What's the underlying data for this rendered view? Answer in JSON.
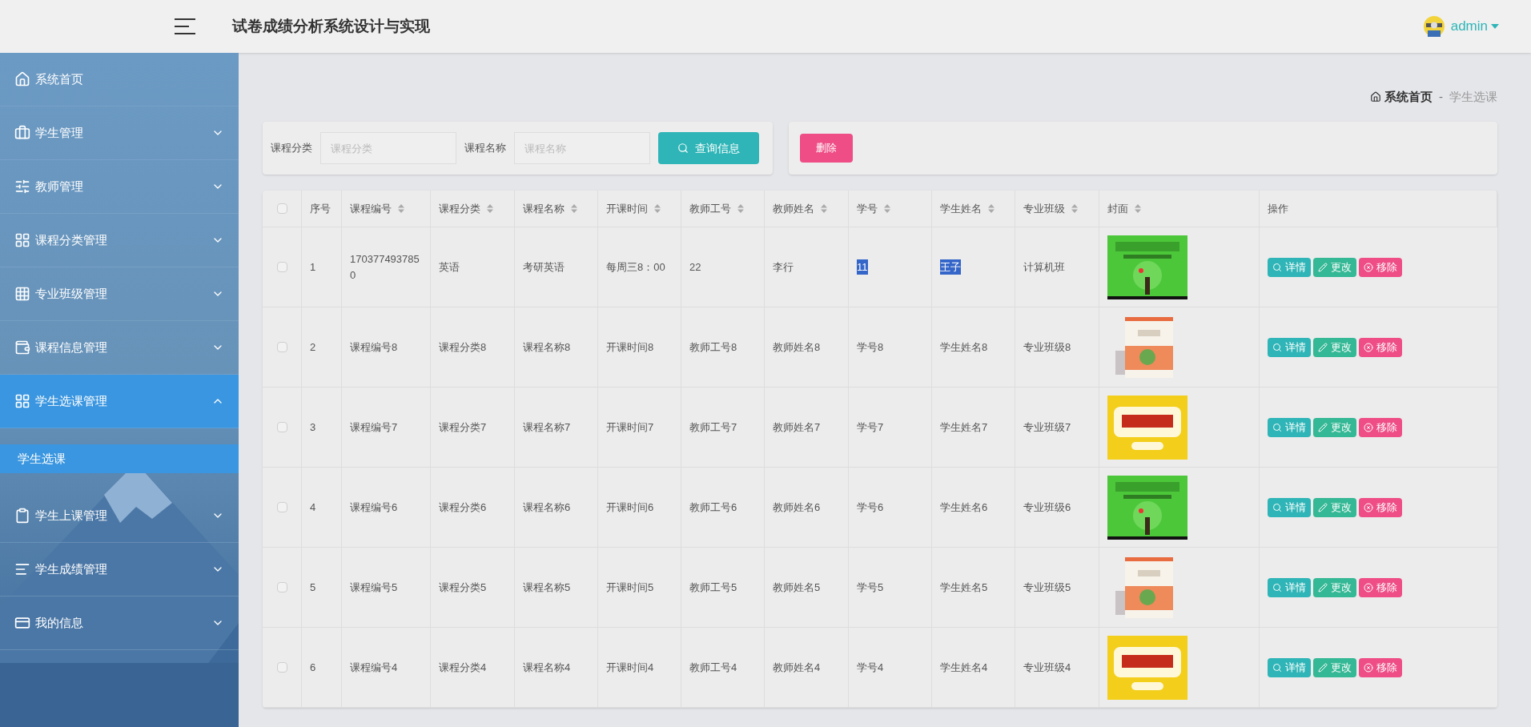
{
  "header": {
    "title": "试卷成绩分析系统设计与实现",
    "user": "admin"
  },
  "sidebar": {
    "items": [
      {
        "label": "系统首页",
        "expandable": false,
        "expanded": false
      },
      {
        "label": "学生管理",
        "expandable": true,
        "expanded": false
      },
      {
        "label": "教师管理",
        "expandable": true,
        "expanded": false
      },
      {
        "label": "课程分类管理",
        "expandable": true,
        "expanded": false
      },
      {
        "label": "专业班级管理",
        "expandable": true,
        "expanded": false
      },
      {
        "label": "课程信息管理",
        "expandable": true,
        "expanded": false
      },
      {
        "label": "学生选课管理",
        "expandable": true,
        "expanded": true,
        "children": [
          {
            "label": "学生选课",
            "selected": true
          }
        ]
      },
      {
        "label": "学生上课管理",
        "expandable": true,
        "expanded": false
      },
      {
        "label": "学生成绩管理",
        "expandable": true,
        "expanded": false
      },
      {
        "label": "我的信息",
        "expandable": true,
        "expanded": false
      }
    ]
  },
  "breadcrumb": {
    "home": "系统首页",
    "separator": "-",
    "current": "学生选课"
  },
  "filters": [
    {
      "label": "课程分类",
      "placeholder": "课程分类"
    },
    {
      "label": "课程名称",
      "placeholder": "课程名称"
    }
  ],
  "search_button": "查询信息",
  "delete_button": "删除",
  "table": {
    "select_all_checked": false,
    "columns": [
      {
        "label": "序号",
        "sortable": false
      },
      {
        "label": "课程编号",
        "sortable": true
      },
      {
        "label": "课程分类",
        "sortable": true
      },
      {
        "label": "课程名称",
        "sortable": true
      },
      {
        "label": "开课时间",
        "sortable": true
      },
      {
        "label": "教师工号",
        "sortable": true
      },
      {
        "label": "教师姓名",
        "sortable": true
      },
      {
        "label": "学号",
        "sortable": true
      },
      {
        "label": "学生姓名",
        "sortable": true
      },
      {
        "label": "专业班级",
        "sortable": true
      },
      {
        "label": "封面",
        "sortable": true
      },
      {
        "label": "操作",
        "sortable": false
      }
    ],
    "rows": [
      {
        "checked": false,
        "cells": [
          {
            "text": "1",
            "highlighted": false
          },
          {
            "text": "1703774937850",
            "highlighted": false
          },
          {
            "text": "英语",
            "highlighted": false
          },
          {
            "text": "考研英语",
            "highlighted": false
          },
          {
            "text": "每周三8：00",
            "highlighted": false
          },
          {
            "text": "22",
            "highlighted": false
          },
          {
            "text": "李行",
            "highlighted": false
          },
          {
            "text": "11",
            "highlighted": true
          },
          {
            "text": "王子",
            "highlighted": true
          },
          {
            "text": "计算机班",
            "highlighted": false
          }
        ],
        "actions": [
          {
            "kind": "view",
            "label": "详情"
          },
          {
            "kind": "edit",
            "label": "更改"
          },
          {
            "kind": "delete",
            "label": "移除"
          }
        ]
      },
      {
        "checked": false,
        "cells": [
          {
            "text": "2",
            "highlighted": false
          },
          {
            "text": "课程编号8",
            "highlighted": false
          },
          {
            "text": "课程分类8",
            "highlighted": false
          },
          {
            "text": "课程名称8",
            "highlighted": false
          },
          {
            "text": "开课时间8",
            "highlighted": false
          },
          {
            "text": "教师工号8",
            "highlighted": false
          },
          {
            "text": "教师姓名8",
            "highlighted": false
          },
          {
            "text": "学号8",
            "highlighted": false
          },
          {
            "text": "学生姓名8",
            "highlighted": false
          },
          {
            "text": "专业班级8",
            "highlighted": false
          }
        ],
        "actions": [
          {
            "kind": "view",
            "label": "详情"
          },
          {
            "kind": "edit",
            "label": "更改"
          },
          {
            "kind": "delete",
            "label": "移除"
          }
        ]
      },
      {
        "checked": false,
        "cells": [
          {
            "text": "3",
            "highlighted": false
          },
          {
            "text": "课程编号7",
            "highlighted": false
          },
          {
            "text": "课程分类7",
            "highlighted": false
          },
          {
            "text": "课程名称7",
            "highlighted": false
          },
          {
            "text": "开课时间7",
            "highlighted": false
          },
          {
            "text": "教师工号7",
            "highlighted": false
          },
          {
            "text": "教师姓名7",
            "highlighted": false
          },
          {
            "text": "学号7",
            "highlighted": false
          },
          {
            "text": "学生姓名7",
            "highlighted": false
          },
          {
            "text": "专业班级7",
            "highlighted": false
          }
        ],
        "actions": [
          {
            "kind": "view",
            "label": "详情"
          },
          {
            "kind": "edit",
            "label": "更改"
          },
          {
            "kind": "delete",
            "label": "移除"
          }
        ]
      },
      {
        "checked": false,
        "cells": [
          {
            "text": "4",
            "highlighted": false
          },
          {
            "text": "课程编号6",
            "highlighted": false
          },
          {
            "text": "课程分类6",
            "highlighted": false
          },
          {
            "text": "课程名称6",
            "highlighted": false
          },
          {
            "text": "开课时间6",
            "highlighted": false
          },
          {
            "text": "教师工号6",
            "highlighted": false
          },
          {
            "text": "教师姓名6",
            "highlighted": false
          },
          {
            "text": "学号6",
            "highlighted": false
          },
          {
            "text": "学生姓名6",
            "highlighted": false
          },
          {
            "text": "专业班级6",
            "highlighted": false
          }
        ],
        "actions": [
          {
            "kind": "view",
            "label": "详情"
          },
          {
            "kind": "edit",
            "label": "更改"
          },
          {
            "kind": "delete",
            "label": "移除"
          }
        ]
      },
      {
        "checked": false,
        "cells": [
          {
            "text": "5",
            "highlighted": false
          },
          {
            "text": "课程编号5",
            "highlighted": false
          },
          {
            "text": "课程分类5",
            "highlighted": false
          },
          {
            "text": "课程名称5",
            "highlighted": false
          },
          {
            "text": "开课时间5",
            "highlighted": false
          },
          {
            "text": "教师工号5",
            "highlighted": false
          },
          {
            "text": "教师姓名5",
            "highlighted": false
          },
          {
            "text": "学号5",
            "highlighted": false
          },
          {
            "text": "学生姓名5",
            "highlighted": false
          },
          {
            "text": "专业班级5",
            "highlighted": false
          }
        ],
        "actions": [
          {
            "kind": "view",
            "label": "详情"
          },
          {
            "kind": "edit",
            "label": "更改"
          },
          {
            "kind": "delete",
            "label": "移除"
          }
        ]
      },
      {
        "checked": false,
        "cells": [
          {
            "text": "6",
            "highlighted": false
          },
          {
            "text": "课程编号4",
            "highlighted": false
          },
          {
            "text": "课程分类4",
            "highlighted": false
          },
          {
            "text": "课程名称4",
            "highlighted": false
          },
          {
            "text": "开课时间4",
            "highlighted": false
          },
          {
            "text": "教师工号4",
            "highlighted": false
          },
          {
            "text": "教师姓名4",
            "highlighted": false
          },
          {
            "text": "学号4",
            "highlighted": false
          },
          {
            "text": "学生姓名4",
            "highlighted": false
          },
          {
            "text": "专业班级4",
            "highlighted": false
          }
        ],
        "actions": [
          {
            "kind": "view",
            "label": "详情"
          },
          {
            "kind": "edit",
            "label": "更改"
          },
          {
            "kind": "delete",
            "label": "移除"
          }
        ]
      }
    ]
  }
}
